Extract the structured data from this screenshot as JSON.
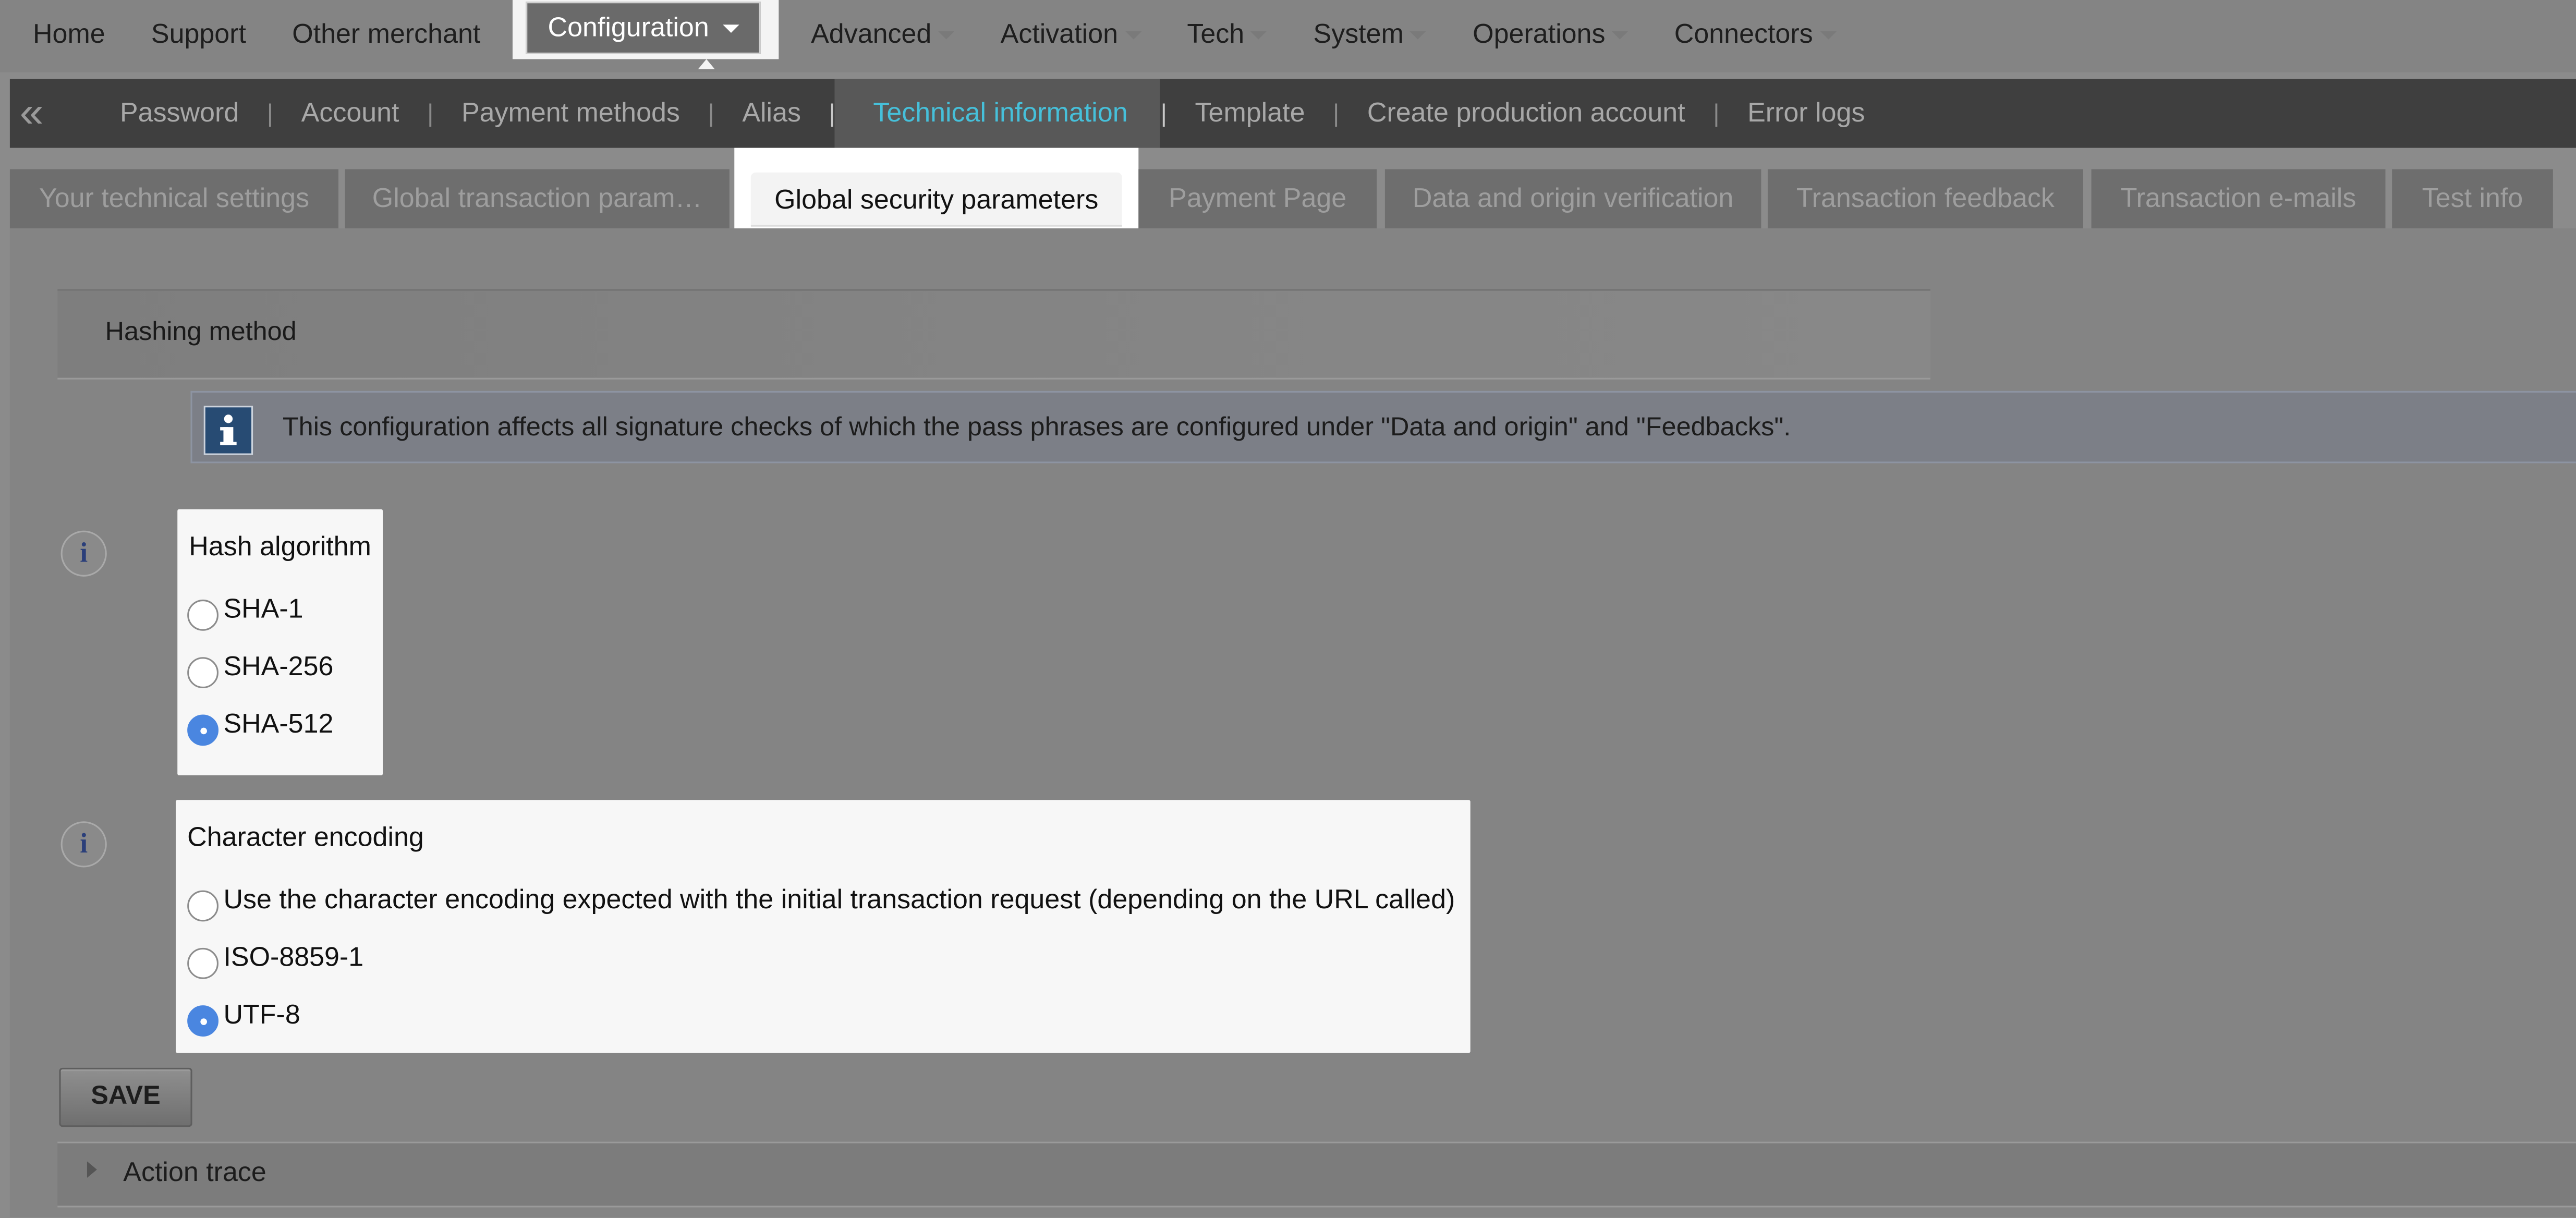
{
  "top_nav": [
    {
      "label": "Home",
      "dropdown": false
    },
    {
      "label": "Support",
      "dropdown": false
    },
    {
      "label": "Other merchant",
      "dropdown": false
    },
    {
      "label": "Configuration",
      "dropdown": true,
      "active": true
    },
    {
      "label": "Advanced",
      "dropdown": true
    },
    {
      "label": "Activation",
      "dropdown": true
    },
    {
      "label": "Tech",
      "dropdown": true
    },
    {
      "label": "System",
      "dropdown": true
    },
    {
      "label": "Operations",
      "dropdown": true
    },
    {
      "label": "Connectors",
      "dropdown": true
    }
  ],
  "sub_nav": {
    "collapse_glyph": "«",
    "separator": "|",
    "items": [
      {
        "label": "Password"
      },
      {
        "label": "Account"
      },
      {
        "label": "Payment methods"
      },
      {
        "label": "Alias"
      },
      {
        "label": "Technical information",
        "current": true
      },
      {
        "label": "Template"
      },
      {
        "label": "Create production account"
      },
      {
        "label": "Error logs"
      }
    ]
  },
  "tabs": [
    {
      "label": "Your technical settings"
    },
    {
      "label": "Global transaction param…"
    },
    {
      "label": "Global security parameters",
      "active": true
    },
    {
      "label": "Payment Page"
    },
    {
      "label": "Data and origin verification"
    },
    {
      "label": "Transaction feedback"
    },
    {
      "label": "Transaction e-mails"
    },
    {
      "label": "Test info"
    }
  ],
  "section": {
    "title": "Hashing method",
    "notice": "This configuration affects all signature checks of which the pass phrases are configured under \"Data and origin\" and \"Feedbacks\"."
  },
  "hash_algorithm": {
    "label": "Hash algorithm",
    "options": [
      {
        "label": "SHA-1",
        "checked": false
      },
      {
        "label": "SHA-256",
        "checked": false
      },
      {
        "label": "SHA-512",
        "checked": true
      }
    ]
  },
  "char_encoding": {
    "label": "Character encoding",
    "options": [
      {
        "label": "Use the character encoding expected with the initial transaction request (depending on the URL called)",
        "checked": false
      },
      {
        "label": "ISO-8859-1",
        "checked": false
      },
      {
        "label": "UTF-8",
        "checked": true
      }
    ]
  },
  "save_label": "SAVE",
  "action_trace_label": "Action trace",
  "info_glyph": "i",
  "colors": {
    "overlay_bg": "#848484",
    "active_link": "#46c0da",
    "radio_checked": "#4a86e0",
    "info_icon": "#2b3f7a"
  }
}
